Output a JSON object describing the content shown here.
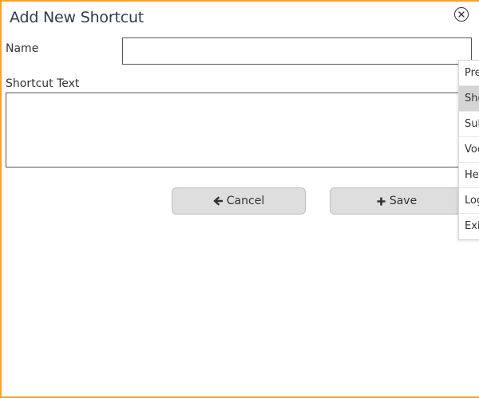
{
  "dialog": {
    "title": "Add New Shortcut",
    "close_icon": "close-circle-icon"
  },
  "form": {
    "name_label": "Name",
    "name_value": "",
    "shortcut_text_label": "Shortcut Text",
    "shortcut_text_value": ""
  },
  "buttons": {
    "cancel_label": "Cancel",
    "cancel_icon": "arrow-left-icon",
    "save_label": "Save",
    "save_icon": "plus-icon"
  },
  "side_menu": {
    "items": [
      {
        "label": "Pre",
        "active": false
      },
      {
        "label": "Sho",
        "active": true
      },
      {
        "label": "Sub",
        "active": false
      },
      {
        "label": "Voc",
        "active": false
      },
      {
        "label": "Hel",
        "active": false
      },
      {
        "label": "Log",
        "active": false
      },
      {
        "label": "Exi",
        "active": false
      }
    ]
  },
  "colors": {
    "frame_border": "#f5a623",
    "button_bg": "#dedede",
    "menu_active_bg": "#d4d4d4",
    "title_text": "#2f3d4c"
  }
}
